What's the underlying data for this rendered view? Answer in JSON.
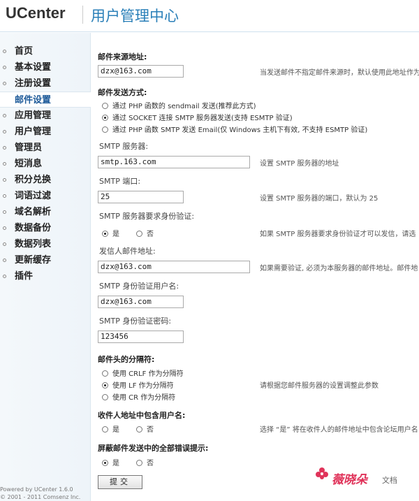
{
  "header": {
    "logo": "UCenter",
    "title": "用户管理中心"
  },
  "sidebar": {
    "items": [
      {
        "label": "首页"
      },
      {
        "label": "基本设置"
      },
      {
        "label": "注册设置"
      },
      {
        "label": "邮件设置",
        "active": true
      },
      {
        "label": "应用管理"
      },
      {
        "label": "用户管理"
      },
      {
        "label": "管理员"
      },
      {
        "label": "短消息"
      },
      {
        "label": "积分兑换"
      },
      {
        "label": "词语过滤"
      },
      {
        "label": "域名解析"
      },
      {
        "label": "数据备份"
      },
      {
        "label": "数据列表"
      },
      {
        "label": "更新缓存"
      },
      {
        "label": "插件"
      }
    ],
    "footer_line1": "Powered by UCenter 1.6.0",
    "footer_line2": "© 2001 - 2011 Comsenz Inc."
  },
  "form": {
    "mail_from": {
      "title": "邮件来源地址:",
      "value": "dzx@163.com",
      "hint": "当发送邮件不指定邮件来源时，默认使用此地址作为"
    },
    "send_method": {
      "title": "邮件发送方式:",
      "options": [
        {
          "label": "通过 PHP 函数的 sendmail 发送(推荐此方式)",
          "checked": false
        },
        {
          "label": "通过 SOCKET 连接 SMTP 服务器发送(支持 ESMTP 验证)",
          "checked": true
        },
        {
          "label": "通过 PHP 函数 SMTP 发送 Email(仅 Windows 主机下有效, 不支持 ESMTP 验证)",
          "checked": false
        }
      ]
    },
    "smtp_server": {
      "label": "SMTP 服务器:",
      "value": "smtp.163.com",
      "hint": "设置 SMTP 服务器的地址"
    },
    "smtp_port": {
      "label": "SMTP 端口:",
      "value": "25",
      "hint": "设置 SMTP 服务器的端口，默认为 25"
    },
    "smtp_auth": {
      "label": "SMTP 服务器要求身份验证:",
      "yes": "是",
      "no": "否",
      "yes_checked": true,
      "hint": "如果 SMTP 服务器要求身份验证才可以发信，请选"
    },
    "sender_email": {
      "label": "发信人邮件地址:",
      "value": "dzx@163.com",
      "hint": "如果需要验证, 必须为本服务器的邮件地址。邮件地"
    },
    "auth_user": {
      "label": "SMTP 身份验证用户名:",
      "value": "dzx@163.com"
    },
    "auth_pass": {
      "label": "SMTP 身份验证密码:",
      "value": "123456"
    },
    "separator": {
      "title": "邮件头的分隔符:",
      "options": [
        {
          "label": "使用 CRLF 作为分隔符",
          "checked": false
        },
        {
          "label": "使用 LF 作为分隔符",
          "checked": true
        },
        {
          "label": "使用 CR 作为分隔符",
          "checked": false
        }
      ],
      "hint": "请根据您邮件服务器的设置调整此参数"
    },
    "include_username": {
      "title": "收件人地址中包含用户名:",
      "yes": "是",
      "no": "否",
      "yes_checked": false,
      "hint": "选择 “是” 将在收件人的邮件地址中包含论坛用户名"
    },
    "silent_errors": {
      "title": "屏蔽邮件发送中的全部错误提示:",
      "yes": "是",
      "no": "否",
      "yes_checked": true
    },
    "submit_label": "提交"
  },
  "watermark": {
    "brand": "薇晓朵",
    "sub": "文档"
  }
}
